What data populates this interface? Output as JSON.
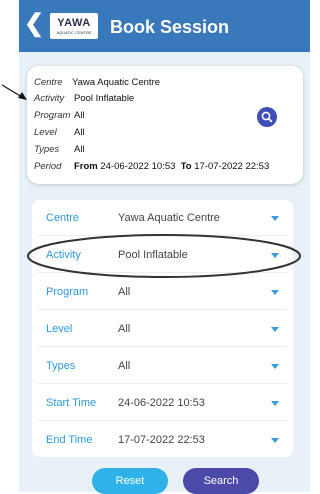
{
  "header": {
    "logo_main": "YAWA",
    "logo_sub": "AQUATIC CENTRE",
    "title": "Book Session"
  },
  "summary": {
    "centre_label": "Centre",
    "centre_value": "Yawa Aquatic Centre",
    "activity_label": "Activity",
    "activity_value": "Pool Inflatable",
    "program_label": "Program",
    "program_value": "All",
    "level_label": "Level",
    "level_value": "All",
    "types_label": "Types",
    "types_value": "All",
    "period_label": "Period",
    "from_label": "From",
    "from_value": "24-06-2022 10:53",
    "to_label": "To",
    "to_value": "17-07-2022 22:53"
  },
  "form": {
    "fields": [
      {
        "label": "Centre",
        "value": "Yawa Aquatic Centre"
      },
      {
        "label": "Activity",
        "value": "Pool Inflatable"
      },
      {
        "label": "Program",
        "value": "All"
      },
      {
        "label": "Level",
        "value": "All"
      },
      {
        "label": "Types",
        "value": "All"
      },
      {
        "label": "Start Time",
        "value": "24-06-2022 10:53"
      },
      {
        "label": "End Time",
        "value": "17-07-2022 22:53"
      }
    ]
  },
  "buttons": {
    "reset_label": "Reset",
    "search_label": "Search"
  },
  "colors": {
    "header": "#3a78bc",
    "field_label": "#2c99da",
    "reset": "#2fb2ea",
    "search": "#4c4aa9"
  }
}
